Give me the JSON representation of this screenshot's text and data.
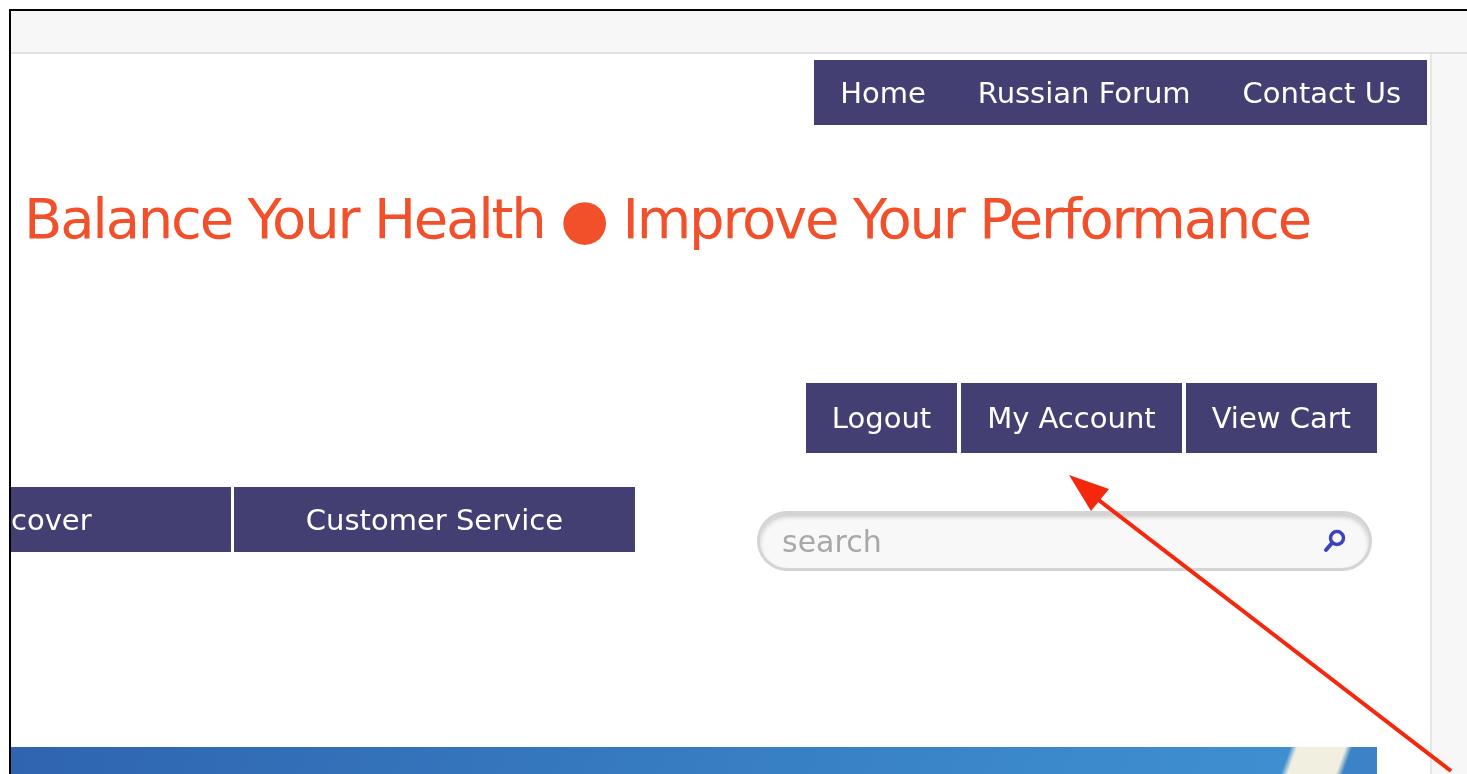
{
  "top_nav": [
    "Home",
    "Russian Forum",
    "Contact Us"
  ],
  "tagline": "Balance Your Health ● Improve Your Performance",
  "account_nav": [
    "Logout",
    "My Account",
    "View Cart"
  ],
  "main_nav": [
    "cover",
    "Customer Service"
  ],
  "search": {
    "placeholder": "search"
  }
}
